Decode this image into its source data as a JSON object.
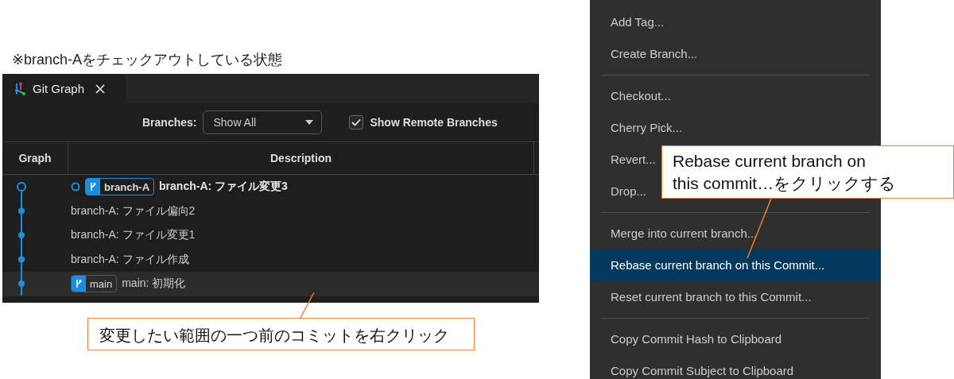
{
  "caption": "※branch-Aをチェックアウトしている状態",
  "tab": {
    "title": "Git Graph",
    "selected": true
  },
  "toolbar": {
    "branches_label": "Branches:",
    "branches_value": "Show All",
    "show_remote": {
      "label": "Show Remote Branches",
      "checked": true
    }
  },
  "columns": [
    "Graph",
    "Description"
  ],
  "commits": [
    {
      "message": "branch-A: ファイル変更3",
      "head": true,
      "selected": false,
      "refs": [
        {
          "name": "branch-A",
          "current": true
        }
      ]
    },
    {
      "message": "branch-A: ファイル偏向2",
      "head": false,
      "selected": false
    },
    {
      "message": "branch-A: ファイル変更1",
      "head": false,
      "selected": false
    },
    {
      "message": "branch-A: ファイル作成",
      "head": false,
      "selected": false
    },
    {
      "message": "main: 初期化",
      "head": false,
      "selected": true,
      "refs": [
        {
          "name": "main",
          "current": false
        }
      ]
    }
  ],
  "context_menu": {
    "groups": [
      [
        {
          "label": "Add Tag...",
          "selected": false
        },
        {
          "label": "Create Branch...",
          "selected": false
        }
      ],
      [
        {
          "label": "Checkout...",
          "selected": false
        },
        {
          "label": "Cherry Pick...",
          "selected": false
        },
        {
          "label": "Revert...",
          "selected": false
        },
        {
          "label": "Drop...",
          "selected": false
        }
      ],
      [
        {
          "label": "Merge into current branch...",
          "selected": false
        },
        {
          "label": "Rebase current branch on this Commit...",
          "selected": true
        },
        {
          "label": "Reset current branch to this Commit...",
          "selected": false
        }
      ],
      [
        {
          "label": "Copy Commit Hash to Clipboard",
          "selected": false
        },
        {
          "label": "Copy Commit Subject to Clipboard",
          "selected": false
        }
      ]
    ]
  },
  "annotations": [
    {
      "text": "変更したい範囲の一つ前のコミットを右クリック"
    },
    {
      "text": "Rebase current branch on\nthis commit…をクリックする"
    }
  ]
}
